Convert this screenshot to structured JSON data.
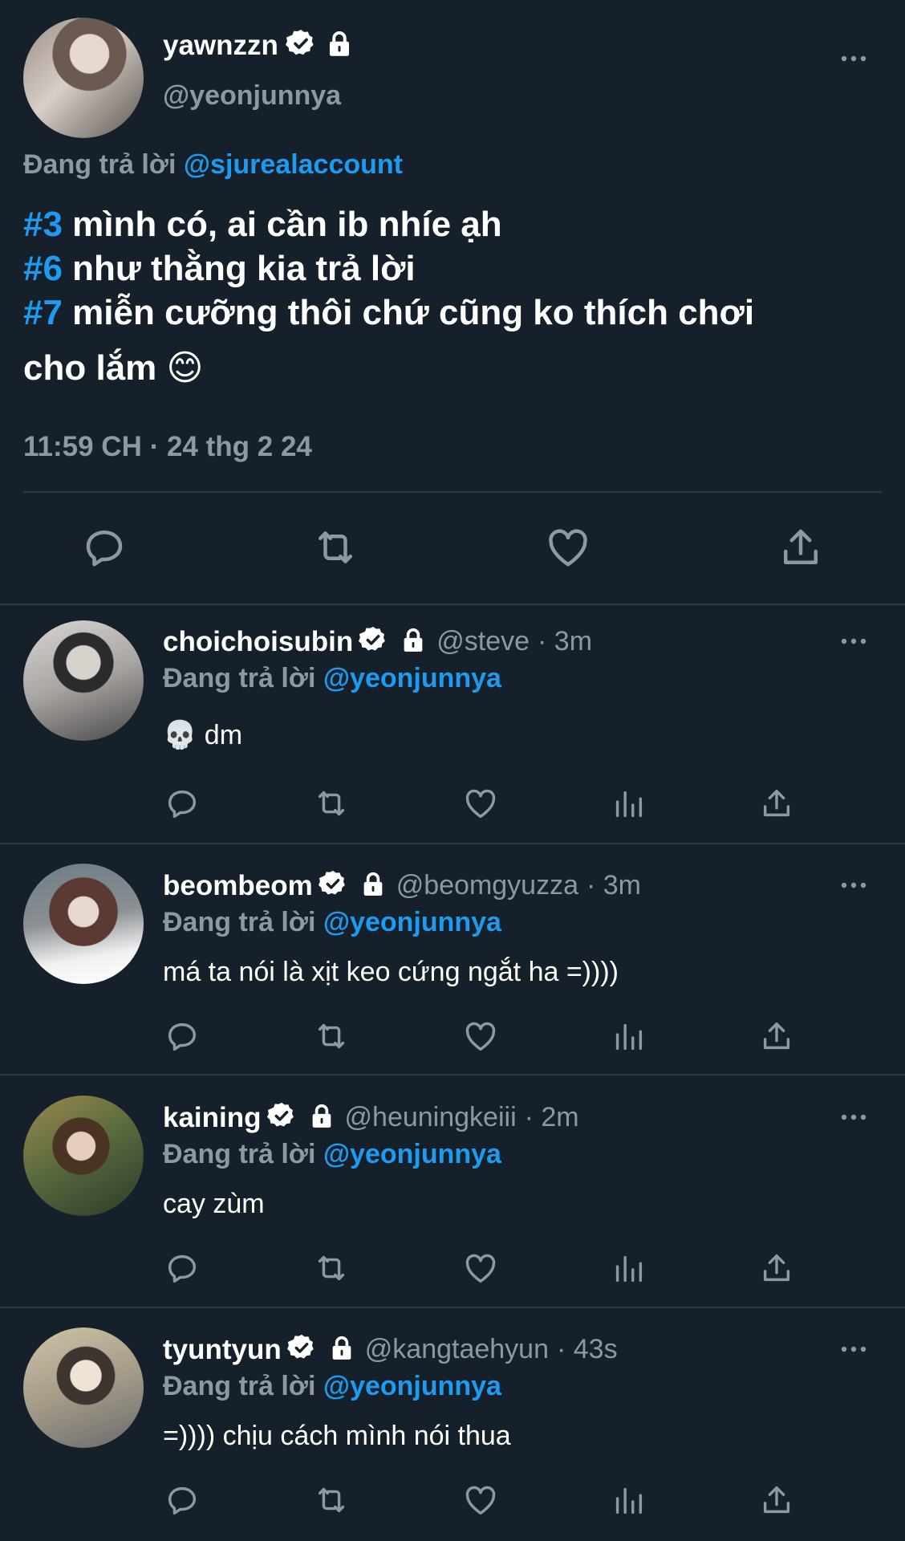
{
  "main_tweet": {
    "display_name": "yawnzzn",
    "handle": "@yeonjunnya",
    "replying_prefix": "Đang trả lời",
    "replying_to": "@sjurealaccount",
    "lines": [
      {
        "tag": "#3",
        "text": " mình có, ai cần ib nhíe ạh"
      },
      {
        "tag": "#6",
        "text": " như thằng kia trả lời"
      },
      {
        "tag": "#7",
        "text": " miễn cưỡng thôi chứ cũng ko thích chơi"
      }
    ],
    "last_line": "cho lắm 😊",
    "timestamp": "11:59 CH · 24 thg 2 24"
  },
  "replies": [
    {
      "name": "choichoisubin",
      "handle": "@steve",
      "time": "· 3m",
      "replying_prefix": "Đang trả lời",
      "replying_to": "@yeonjunnya",
      "text": "💀 dm"
    },
    {
      "name": "beombeom",
      "handle": "@beomgyuzza",
      "time": "· 3m",
      "replying_prefix": "Đang trả lời",
      "replying_to": "@yeonjunnya",
      "text": "má ta nói là xịt keo cứng ngắt ha =))))"
    },
    {
      "name": "kaining",
      "handle": "@heuningkeiii",
      "time": "· 2m",
      "replying_prefix": "Đang trả lời",
      "replying_to": "@yeonjunnya",
      "text": "cay zùm"
    },
    {
      "name": "tyuntyun",
      "handle": "@kangtaehyun",
      "time": "· 43s",
      "replying_prefix": "Đang trả lời",
      "replying_to": "@yeonjunnya",
      "text": "=)))) chịu cách mình nói thua"
    }
  ],
  "colors": {
    "background": "#15202b",
    "accent": "#1d9bf0",
    "muted": "#8b98a5",
    "divider": "#2f3b47"
  },
  "icons": [
    "verified-badge-icon",
    "lock-icon",
    "more-icon",
    "reply-icon",
    "retweet-icon",
    "like-icon",
    "views-icon",
    "share-icon"
  ]
}
